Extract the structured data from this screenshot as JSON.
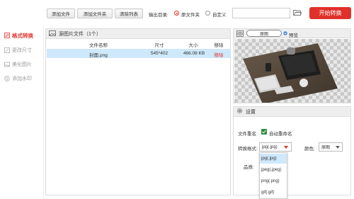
{
  "sidebar": {
    "items": [
      {
        "label": "格式转换",
        "active": true
      },
      {
        "label": "更改尺寸",
        "active": false
      },
      {
        "label": "美化图片",
        "active": false
      },
      {
        "label": "添加水印",
        "active": false
      }
    ]
  },
  "toolbar": {
    "add_file": "添加文件",
    "add_folder": "添加文件夹",
    "clear_list": "清除列表",
    "output_dir_label": "输出目录:",
    "option_source": "原文件夹",
    "option_custom": "自定义",
    "output_path": "",
    "start_button": "开始转换"
  },
  "file_panel": {
    "title": "源图片文件（1个）",
    "columns": [
      "文件名称",
      "尺寸",
      "大小",
      "移除"
    ],
    "rows": [
      {
        "name": "封面.png",
        "size": "545*402",
        "filesize": "466.08 KB",
        "remove": "移除"
      }
    ]
  },
  "preview": {
    "mode": "原图",
    "label": "预览"
  },
  "settings": {
    "title": "设置",
    "rename_label": "文件重名:",
    "auto_rename": "自动重命名",
    "format_label": "转换格式:",
    "format_value": "jpg(.jpg)",
    "color_label": "颜色:",
    "color_value": "原图",
    "quality_label": "品质:",
    "format_options": [
      "jpg(.jpg)",
      "jpeg(.jpeg)",
      "png(.png)",
      "gif(.gif)"
    ]
  },
  "colors": {
    "accent": "#e0302a",
    "selected_row": "#cfe8fb"
  }
}
